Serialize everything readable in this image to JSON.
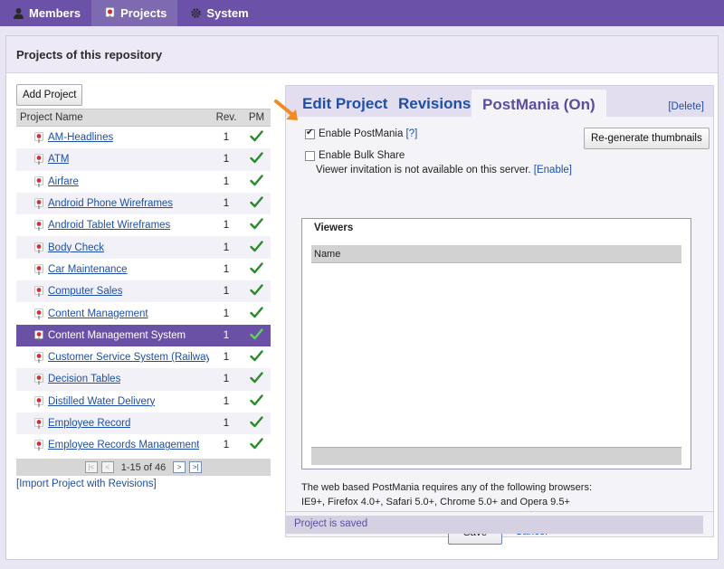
{
  "nav": {
    "tabs": [
      {
        "label": "Members",
        "icon": "person-icon"
      },
      {
        "label": "Projects",
        "icon": "pin-icon",
        "active": true
      },
      {
        "label": "System",
        "icon": "gear-icon"
      }
    ]
  },
  "page": {
    "title": "Projects of this repository"
  },
  "left": {
    "add_button": "Add Project",
    "columns": {
      "name": "Project Name",
      "rev": "Rev.",
      "pm": "PM"
    },
    "projects": [
      {
        "name": "AM-Headlines",
        "rev": "1"
      },
      {
        "name": "ATM",
        "rev": "1"
      },
      {
        "name": "Airfare",
        "rev": "1"
      },
      {
        "name": "Android Phone Wireframes",
        "rev": "1"
      },
      {
        "name": "Android Tablet Wireframes",
        "rev": "1"
      },
      {
        "name": "Body Check",
        "rev": "1"
      },
      {
        "name": "Car Maintenance",
        "rev": "1"
      },
      {
        "name": "Computer Sales",
        "rev": "1"
      },
      {
        "name": "Content Management",
        "rev": "1"
      },
      {
        "name": "Content Management System",
        "rev": "1",
        "selected": true
      },
      {
        "name": "Customer Service System (Railway",
        "rev": "1"
      },
      {
        "name": "Decision Tables",
        "rev": "1"
      },
      {
        "name": "Distilled Water Delivery",
        "rev": "1"
      },
      {
        "name": "Employee Record",
        "rev": "1"
      },
      {
        "name": "Employee Records Management",
        "rev": "1"
      }
    ],
    "pager": "1-15 of 46",
    "import_link": "[Import Project with Revisions]"
  },
  "right": {
    "tabs": {
      "edit": "Edit Project",
      "revisions": "Revisions",
      "postmania": "PostMania (On)"
    },
    "delete_link": "[Delete]",
    "enable_postmania": "Enable PostMania",
    "help_link": "[?]",
    "regen_button": "Re-generate thumbnails",
    "enable_bulk": "Enable Bulk Share",
    "viewer_note": "Viewer invitation is not available on this server.",
    "enable_link": "[Enable]",
    "viewers_title": "Viewers",
    "viewers_col": "Name",
    "browsers_line1": "The web based PostMania requires any of the following browsers:",
    "browsers_line2": "IE9+, Firefox 4.0+, Safari 5.0+, Chrome 5.0+ and Opera 9.5+",
    "save_button": "Save",
    "cancel_link": "Cancel"
  },
  "status": "Project is saved",
  "colors": {
    "nav": "#6b52a8",
    "selected_row": "#6a51a6",
    "link": "#1d4fa8",
    "check": "#2a8a2a",
    "arrow": "#f08a24"
  }
}
